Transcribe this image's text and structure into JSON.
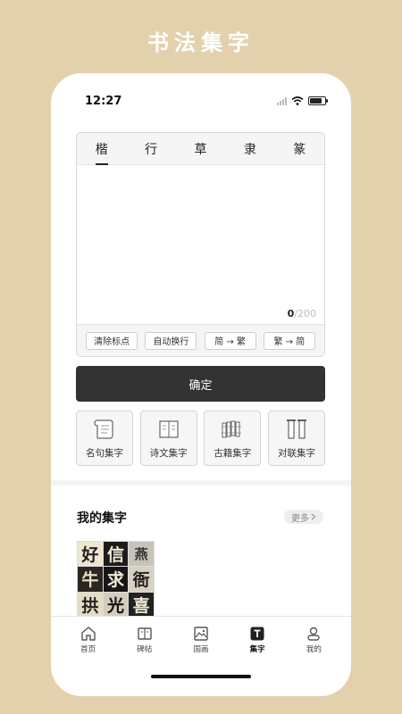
{
  "banner": {
    "title": "书法集字"
  },
  "status": {
    "time": "12:27"
  },
  "editor": {
    "tabs": [
      {
        "label": "楷",
        "active": true
      },
      {
        "label": "行",
        "active": false
      },
      {
        "label": "草",
        "active": false
      },
      {
        "label": "隶",
        "active": false
      },
      {
        "label": "篆",
        "active": false
      }
    ],
    "text_value": "",
    "char_count_current": "0",
    "char_count_max": "/200",
    "tools": [
      "清除标点",
      "自动换行",
      "简 → 繁",
      "繁 → 简"
    ]
  },
  "confirm_label": "确定",
  "categories": [
    {
      "label": "名句集字",
      "icon": "scroll-icon"
    },
    {
      "label": "诗文集字",
      "icon": "book-icon"
    },
    {
      "label": "古籍集字",
      "icon": "bamboo-slips-icon"
    },
    {
      "label": "对联集字",
      "icon": "couplet-icon"
    }
  ],
  "my_works": {
    "title": "我的集字",
    "more_label": "更多",
    "chars": [
      "好",
      "信",
      "燕",
      "牛",
      "求",
      "衙",
      "拱",
      "光",
      "喜"
    ]
  },
  "tab_bar": {
    "items": [
      {
        "label": "首页",
        "icon": "home-icon",
        "active": false
      },
      {
        "label": "碑帖",
        "icon": "book-open-icon",
        "active": false
      },
      {
        "label": "国画",
        "icon": "image-icon",
        "active": false
      },
      {
        "label": "集字",
        "icon": "text-t-icon",
        "active": true
      },
      {
        "label": "我的",
        "icon": "user-icon",
        "active": false
      }
    ]
  },
  "colors": {
    "background": "#e3d1ae",
    "primary": "#333333",
    "accent_text": "#ffffff"
  }
}
